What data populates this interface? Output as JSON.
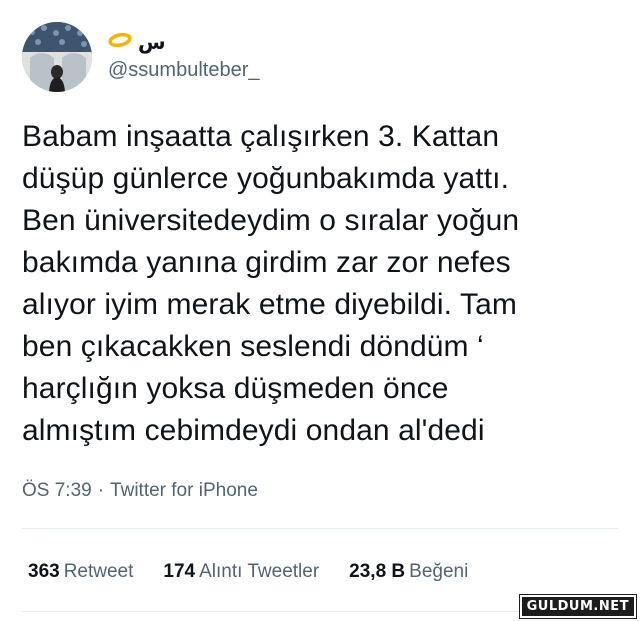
{
  "author": {
    "display_name": "س",
    "handle": "@ssumbulteber_",
    "name_emoji_icon": "halo-icon"
  },
  "tweet": {
    "text": "Babam inşaatta çalışırken 3. Kattan\ndüşüp günlerce yoğunbakımda yattı.\nBen üniversitedeydim o sıralar yoğun\nbakımda yanına girdim zar zor nefes\nalıyor iyim merak etme diyebildi. Tam\nben çıkacakken seslendi döndüm ‘\nharçlığın yoksa düşmeden önce\nalmıştım cebimdeydi ondan al'dedi"
  },
  "meta": {
    "time": "ÖS 7:39",
    "separator": "·",
    "source": "Twitter for iPhone"
  },
  "stats": {
    "retweets_count": "363",
    "retweets_label": "Retweet",
    "quotes_count": "174",
    "quotes_label": "Alıntı Tweetler",
    "likes_count": "23,8 B",
    "likes_label": "Beğeni"
  },
  "watermark": {
    "text": "GULDUM.NET"
  },
  "colors": {
    "primary_text": "#0f1419",
    "secondary_text": "#536471",
    "divider": "#e6ecf0",
    "halo": "#f5b400"
  }
}
